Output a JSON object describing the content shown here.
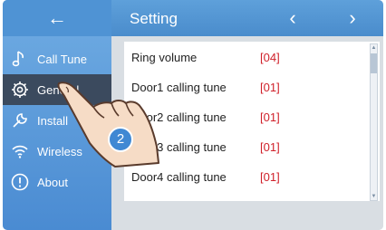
{
  "header": {
    "back_icon": "←",
    "title": "Setting",
    "prev_icon": "‹",
    "next_icon": "›"
  },
  "sidebar": {
    "items": [
      {
        "label": "Call Tune",
        "icon": "music-note-icon"
      },
      {
        "label": "General",
        "icon": "gear-icon"
      },
      {
        "label": "Install",
        "icon": "wrench-icon"
      },
      {
        "label": "Wireless",
        "icon": "wifi-icon"
      },
      {
        "label": "About",
        "icon": "info-icon"
      }
    ],
    "active_index": 1
  },
  "settings": [
    {
      "label": "Ring volume",
      "value": "[04]"
    },
    {
      "label": "Door1 calling tune",
      "value": "[01]"
    },
    {
      "label": "Door2 calling tune",
      "value": "[01]"
    },
    {
      "label": "Door3 calling tune",
      "value": "[01]"
    },
    {
      "label": "Door4 calling tune",
      "value": "[01]"
    }
  ],
  "annotation": {
    "step_number": "2"
  },
  "colors": {
    "header": "#4a8ccc",
    "sidebar": "#5d9bdc",
    "active_item": "#3b4a5e",
    "value_red": "#d0202a"
  }
}
